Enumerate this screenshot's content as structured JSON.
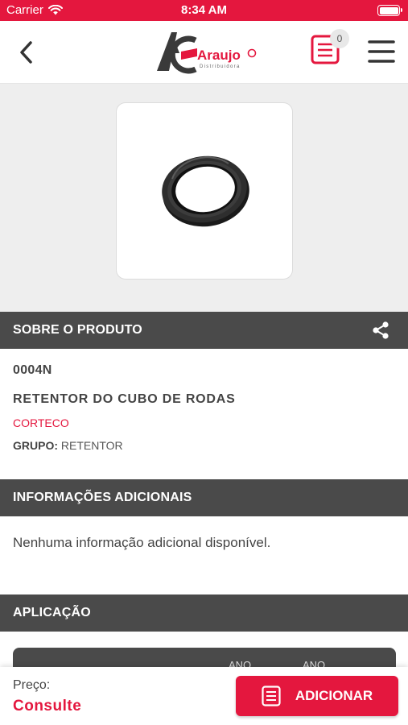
{
  "status_bar": {
    "carrier": "Carrier",
    "time": "8:34 AM"
  },
  "header": {
    "logo_text": "Araujo",
    "logo_subtext": "Distribuidora",
    "cart_count": "0",
    "icons": [
      "chevron-left-icon",
      "list-cart-icon",
      "hamburger-menu-icon"
    ]
  },
  "product": {
    "image": "oil-seal-ring-photo",
    "code": "0004N",
    "name": "RETENTOR DO CUBO DE RODAS",
    "brand": "CORTECO",
    "group_label": "GRUPO:",
    "group_value": "RETENTOR"
  },
  "sections": {
    "about": "SOBRE O PRODUTO",
    "additional": "INFORMAÇÕES ADICIONAIS",
    "application": "APLICAÇÃO"
  },
  "additional_info": "Nenhuma informação adicional disponível.",
  "application_table": {
    "columns": [
      "ANO",
      "ANO"
    ]
  },
  "footer": {
    "price_label": "Preço:",
    "price_value": "Consulte",
    "add_button": "ADICIONAR"
  },
  "colors": {
    "brand_red": "#e4173e",
    "section_gray": "#4a4a4a",
    "image_bg": "#eeeeee"
  }
}
